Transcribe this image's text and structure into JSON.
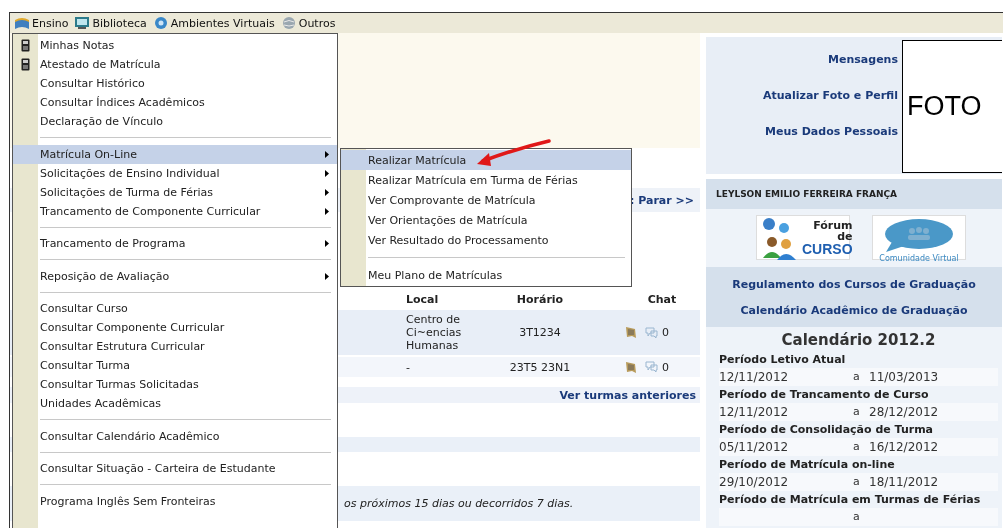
{
  "menubar": [
    {
      "label": "Ensino"
    },
    {
      "label": "Biblioteca"
    },
    {
      "label": "Ambientes Virtuais"
    },
    {
      "label": "Outros"
    }
  ],
  "ensino_menu": [
    {
      "kind": "item",
      "label": "Minhas Notas",
      "icon": true,
      "submenu": false,
      "selected": false
    },
    {
      "kind": "item",
      "label": "Atestado de Matrícula",
      "icon": true,
      "submenu": false,
      "selected": false
    },
    {
      "kind": "item",
      "label": "Consultar Histórico",
      "icon": false,
      "submenu": false,
      "selected": false
    },
    {
      "kind": "item",
      "label": "Consultar Índices Acadêmicos",
      "icon": false,
      "submenu": false,
      "selected": false
    },
    {
      "kind": "item",
      "label": "Declaração de Vínculo",
      "icon": false,
      "submenu": false,
      "selected": false
    },
    {
      "kind": "separator"
    },
    {
      "kind": "item",
      "label": "Matrícula On-Line",
      "icon": false,
      "submenu": true,
      "selected": true
    },
    {
      "kind": "item",
      "label": "Solicitações de Ensino Individual",
      "icon": false,
      "submenu": true,
      "selected": false
    },
    {
      "kind": "item",
      "label": "Solicitações de Turma de Férias",
      "icon": false,
      "submenu": true,
      "selected": false
    },
    {
      "kind": "item",
      "label": "Trancamento de Componente Curricular",
      "icon": false,
      "submenu": true,
      "selected": false
    },
    {
      "kind": "separator"
    },
    {
      "kind": "item",
      "label": "Trancamento de Programa",
      "icon": false,
      "submenu": true,
      "selected": false
    },
    {
      "kind": "separator"
    },
    {
      "kind": "item",
      "label": "Reposição de Avaliação",
      "icon": false,
      "submenu": true,
      "selected": false
    },
    {
      "kind": "separator"
    },
    {
      "kind": "item",
      "label": "Consultar Curso",
      "icon": false,
      "submenu": false,
      "selected": false
    },
    {
      "kind": "item",
      "label": "Consultar Componente Curricular",
      "icon": false,
      "submenu": false,
      "selected": false
    },
    {
      "kind": "item",
      "label": "Consultar Estrutura Curricular",
      "icon": false,
      "submenu": false,
      "selected": false
    },
    {
      "kind": "item",
      "label": "Consultar Turma",
      "icon": false,
      "submenu": false,
      "selected": false
    },
    {
      "kind": "item",
      "label": "Consultar Turmas Solicitadas",
      "icon": false,
      "submenu": false,
      "selected": false
    },
    {
      "kind": "item",
      "label": "Unidades Acadêmicas",
      "icon": false,
      "submenu": false,
      "selected": false
    },
    {
      "kind": "separator"
    },
    {
      "kind": "item",
      "label": "Consultar Calendário Acadêmico",
      "icon": false,
      "submenu": false,
      "selected": false
    },
    {
      "kind": "separator"
    },
    {
      "kind": "item",
      "label": "Consultar Situação - Carteira de Estudante",
      "icon": false,
      "submenu": false,
      "selected": false
    },
    {
      "kind": "separator"
    },
    {
      "kind": "item",
      "label": "Programa Inglês Sem Fronteiras",
      "icon": false,
      "submenu": false,
      "selected": false
    }
  ],
  "submenu": [
    {
      "kind": "item",
      "label": "Realizar Matrícula",
      "selected": true
    },
    {
      "kind": "item",
      "label": "Realizar Matrícula em Turma de Férias",
      "selected": false
    },
    {
      "kind": "item",
      "label": "Ver Comprovante de Matrícula",
      "selected": false
    },
    {
      "kind": "item",
      "label": "Ver Orientações de Matrícula",
      "selected": false
    },
    {
      "kind": "item",
      "label": "Ver Resultado do Processamento",
      "selected": false
    },
    {
      "kind": "separator"
    },
    {
      "kind": "item",
      "label": "Meu Plano de Matrículas",
      "selected": false
    }
  ],
  "main": {
    "pager_link": ": Parar >>",
    "table": {
      "columns": [
        "Local",
        "Horário",
        "Chat"
      ],
      "rows": [
        {
          "local": "Centro de Ci~encias Humanas",
          "horario": "3T1234",
          "chat_count": "0"
        },
        {
          "local": "-",
          "horario": "23T5 23N1",
          "chat_count": "0"
        }
      ]
    },
    "previous_link": "Ver turmas anteriores",
    "notice": "os próximos 15 dias ou decorridos 7 dias."
  },
  "sidebar": {
    "links": [
      "Mensagens",
      "Atualizar Foto e Perfil",
      "Meus Dados Pessoais"
    ],
    "photo_label": "FOTO",
    "user_name": "LEYLSON EMILIO FERREIRA FRANÇA",
    "badges": [
      {
        "kind": "forum",
        "lines": [
          "Fórum",
          "de",
          "CURSO"
        ]
      },
      {
        "kind": "community",
        "lines": [
          "Comunidade Virtual"
        ]
      }
    ],
    "links2": [
      "Regulamento dos Cursos de Graduação",
      "Calendário Acadêmico de Graduação"
    ],
    "calendar": {
      "title": "Calendário 2012.2",
      "periods": [
        {
          "name": "Período Letivo Atual",
          "start": "12/11/2012",
          "separator": "a",
          "end": "11/03/2013"
        },
        {
          "name": "Período de Trancamento de Curso",
          "start": "12/11/2012",
          "separator": "a",
          "end": "28/12/2012"
        },
        {
          "name": "Período de Consolidação de Turma",
          "start": "05/11/2012",
          "separator": "a",
          "end": "16/12/2012"
        },
        {
          "name": "Período de Matrícula on-line",
          "start": "29/10/2012",
          "separator": "a",
          "end": "18/11/2012"
        },
        {
          "name": "Período de Matrícula em Turmas de Férias",
          "separator": "a"
        }
      ]
    }
  }
}
